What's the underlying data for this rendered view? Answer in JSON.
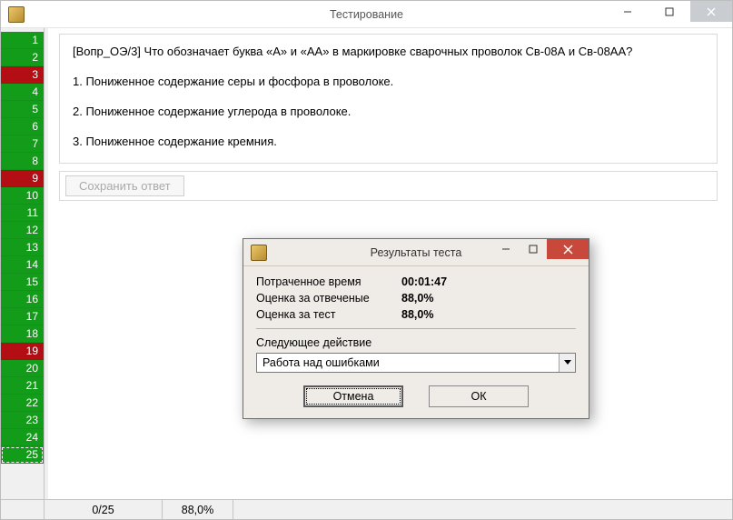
{
  "window": {
    "title": "Тестирование"
  },
  "sidebar": {
    "items": [
      {
        "n": 1,
        "state": "green"
      },
      {
        "n": 2,
        "state": "green"
      },
      {
        "n": 3,
        "state": "red"
      },
      {
        "n": 4,
        "state": "green"
      },
      {
        "n": 5,
        "state": "green"
      },
      {
        "n": 6,
        "state": "green"
      },
      {
        "n": 7,
        "state": "green"
      },
      {
        "n": 8,
        "state": "green"
      },
      {
        "n": 9,
        "state": "red"
      },
      {
        "n": 10,
        "state": "green"
      },
      {
        "n": 11,
        "state": "green"
      },
      {
        "n": 12,
        "state": "green"
      },
      {
        "n": 13,
        "state": "green"
      },
      {
        "n": 14,
        "state": "green"
      },
      {
        "n": 15,
        "state": "green"
      },
      {
        "n": 16,
        "state": "green"
      },
      {
        "n": 17,
        "state": "green"
      },
      {
        "n": 18,
        "state": "green"
      },
      {
        "n": 19,
        "state": "red"
      },
      {
        "n": 20,
        "state": "green"
      },
      {
        "n": 21,
        "state": "green"
      },
      {
        "n": 22,
        "state": "green"
      },
      {
        "n": 23,
        "state": "green"
      },
      {
        "n": 24,
        "state": "green"
      },
      {
        "n": 25,
        "state": "green",
        "selected": true
      }
    ]
  },
  "question": {
    "prompt": "[Вопр_ОЭ/3] Что обозначает буква «А» и «АА» в маркировке сварочных проволок Св-08А и Св-08АА?",
    "options": [
      "1. Пониженное содержание серы и фосфора в проволоке.",
      "2. Пониженное содержание углерода в проволоке.",
      "3. Пониженное содержание кремния."
    ],
    "save_label": "Сохранить ответ"
  },
  "status": {
    "progress": "0/25",
    "score": "88,0%"
  },
  "dialog": {
    "title": "Результаты теста",
    "rows": {
      "time_label": "Потраченное время",
      "time_value": "00:01:47",
      "answered_label": "Оценка за отвеченые",
      "answered_value": "88,0%",
      "test_label": "Оценка за тест",
      "test_value": "88,0%"
    },
    "next_label": "Следующее действие",
    "combo_value": "Работа над ошибками",
    "cancel": "Отмена",
    "ok": "ОК"
  }
}
